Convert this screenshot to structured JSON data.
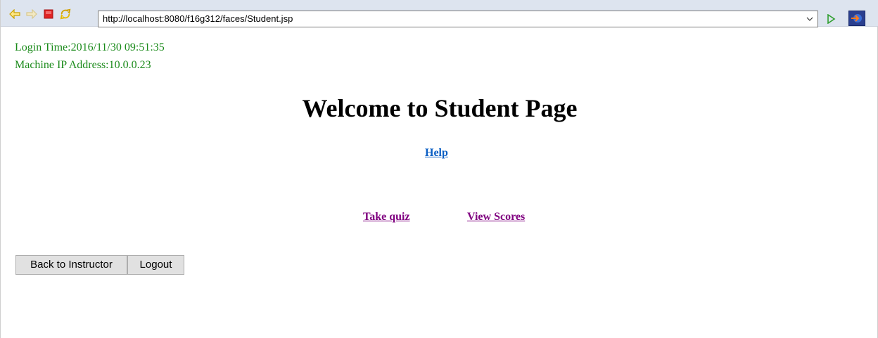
{
  "browser": {
    "url": "http://localhost:8080/f16g312/faces/Student.jsp"
  },
  "info": {
    "login_time": "Login Time:2016/11/30 09:51:35",
    "machine_ip": "Machine IP Address:10.0.0.23"
  },
  "page": {
    "title": "Welcome to Student Page",
    "help_link": "Help",
    "take_quiz_link": "Take quiz",
    "view_scores_link": "View Scores"
  },
  "buttons": {
    "back_label": "Back to Instructor",
    "logout_label": "Logout"
  },
  "colors": {
    "info_text": "#1a8a1a",
    "help_link": "#0b5fc4",
    "visited_link": "#800080"
  },
  "icons": {
    "back": "back-arrow-icon",
    "forward": "forward-arrow-icon",
    "stop": "stop-icon",
    "refresh": "refresh-icon",
    "dropdown": "chevron-down-icon",
    "go": "go-play-icon",
    "external": "open-external-browser-icon"
  }
}
